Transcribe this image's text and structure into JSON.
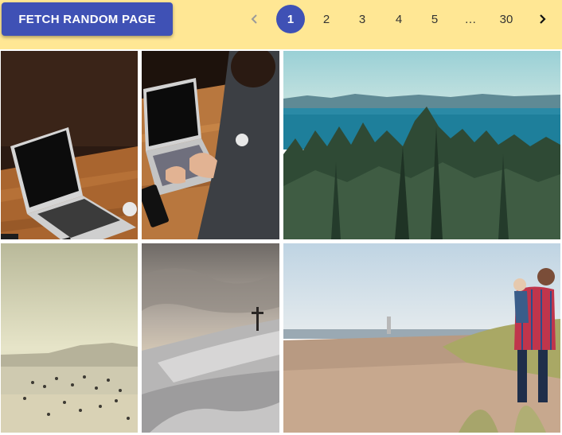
{
  "toolbar": {
    "fetch_label": "FETCH RANDOM PAGE"
  },
  "pagination": {
    "prev_icon": "chevron-left-icon",
    "next_icon": "chevron-right-icon",
    "pages": [
      "1",
      "2",
      "3",
      "4",
      "5",
      "…",
      "30"
    ],
    "current": "1"
  },
  "colors": {
    "topbar_bg": "#ffe794",
    "accent": "#3f51b5"
  },
  "gallery": {
    "images": [
      {
        "subject": "laptop-on-wooden-desk"
      },
      {
        "subject": "person-typing-on-laptop"
      },
      {
        "subject": "forest-and-sea-landscape"
      },
      {
        "subject": "misty-beach-crowd"
      },
      {
        "subject": "snowy-hill-with-cross"
      },
      {
        "subject": "father-carrying-child-on-beach"
      }
    ]
  }
}
